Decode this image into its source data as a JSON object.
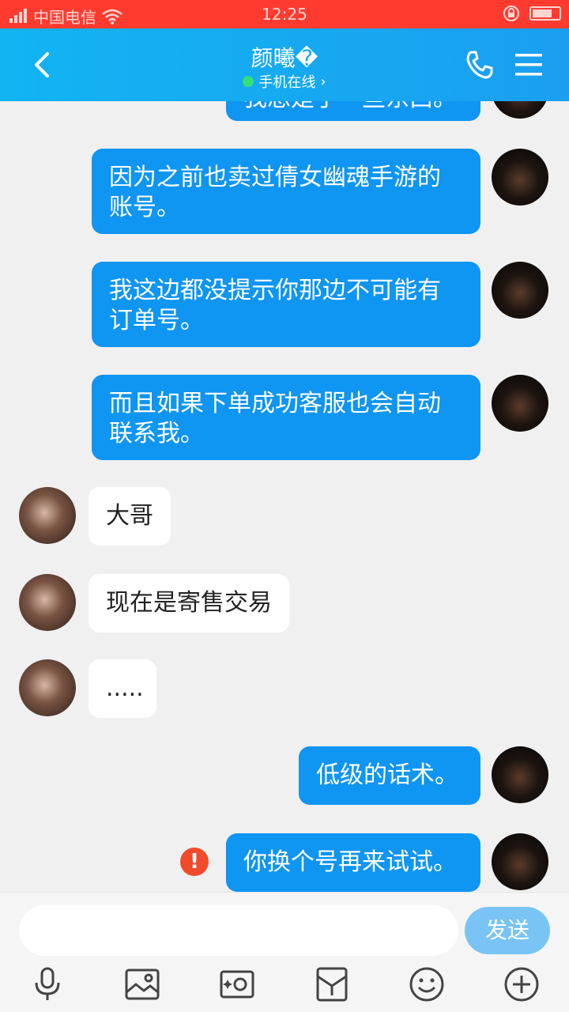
{
  "status": {
    "carrier": "中国电信",
    "time": "12:25"
  },
  "header": {
    "title": "颜曦�",
    "subtitle": "手机在线",
    "subtitle_chevron": "›"
  },
  "messages": [
    {
      "from": "me",
      "text": "我想是了一些东西。"
    },
    {
      "from": "me",
      "text": "因为之前也卖过倩女幽魂手游的账号。"
    },
    {
      "from": "me",
      "text": "我这边都没提示你那边不可能有订单号。"
    },
    {
      "from": "me",
      "text": "而且如果下单成功客服也会自动联系我。"
    },
    {
      "from": "them",
      "text": "大哥"
    },
    {
      "from": "them",
      "text": "现在是寄售交易"
    },
    {
      "from": "them",
      "text": "....."
    },
    {
      "from": "me",
      "text": "低级的话术。"
    },
    {
      "from": "me",
      "text": "你换个号再来试试。",
      "error": "!"
    }
  ],
  "input": {
    "placeholder": "",
    "send_label": "发送"
  },
  "toolbar": {
    "icons": [
      "microphone-icon",
      "image-icon",
      "camera-icon",
      "red-packet-icon",
      "emoji-icon",
      "plus-icon"
    ]
  }
}
